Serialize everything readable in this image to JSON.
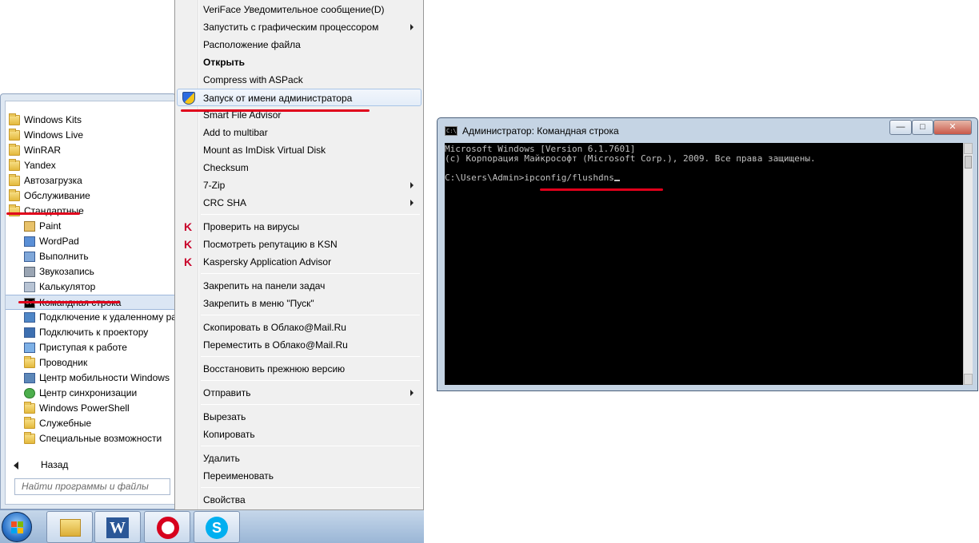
{
  "start_menu": {
    "folders": [
      {
        "label": "Windows Kits"
      },
      {
        "label": "Windows Live"
      },
      {
        "label": "WinRAR"
      },
      {
        "label": "Yandex"
      },
      {
        "label": "Автозагрузка"
      },
      {
        "label": "Обслуживание"
      },
      {
        "label": "Стандартные"
      }
    ],
    "accessories": [
      {
        "label": "Paint",
        "icon": "paint-icon"
      },
      {
        "label": "WordPad",
        "icon": "wordpad-icon"
      },
      {
        "label": "Выполнить",
        "icon": "run-icon"
      },
      {
        "label": "Звукозапись",
        "icon": "microphone-icon"
      },
      {
        "label": "Калькулятор",
        "icon": "calculator-icon"
      },
      {
        "label": "Командная строка",
        "icon": "cmd-icon"
      },
      {
        "label": "Подключение к удаленному ра",
        "icon": "remote-desktop-icon"
      },
      {
        "label": "Подключить к проектору",
        "icon": "projector-icon"
      },
      {
        "label": "Приступая к работе",
        "icon": "getting-started-icon"
      },
      {
        "label": "Проводник",
        "icon": "explorer-icon"
      },
      {
        "label": "Центр мобильности Windows",
        "icon": "mobility-center-icon"
      },
      {
        "label": "Центр синхронизации",
        "icon": "sync-center-icon"
      },
      {
        "label": "Windows PowerShell",
        "icon": "folder-icon"
      },
      {
        "label": "Служебные",
        "icon": "folder-icon"
      },
      {
        "label": "Специальные возможности",
        "icon": "folder-icon"
      }
    ],
    "back_label": "Назад",
    "search_placeholder": "Найти программы и файлы"
  },
  "context_menu": {
    "items": [
      {
        "label": "VeriFace Уведомительное сообщение(D)"
      },
      {
        "label": "Запустить с графическим процессором",
        "submenu": true
      },
      {
        "label": "Расположение файла"
      },
      {
        "label": "Открыть",
        "bold": true
      },
      {
        "label": "Compress with ASPack"
      },
      {
        "label": "Запуск от имени администратора",
        "icon": "uac-shield-icon",
        "highlighted": true
      },
      {
        "label": "Smart File Advisor"
      },
      {
        "label": "Add to multibar"
      },
      {
        "label": "Mount as ImDisk Virtual Disk"
      },
      {
        "label": "Checksum"
      },
      {
        "label": "7-Zip",
        "submenu": true
      },
      {
        "label": "CRC SHA",
        "submenu": true
      },
      {
        "label": "Проверить на вирусы",
        "icon": "kaspersky-icon"
      },
      {
        "label": "Посмотреть репутацию в KSN",
        "icon": "kaspersky-icon"
      },
      {
        "label": "Kaspersky Application Advisor",
        "icon": "kaspersky-icon"
      },
      {
        "label": "Закрепить на панели задач"
      },
      {
        "label": "Закрепить в меню \"Пуск\""
      },
      {
        "label": "Скопировать в Облако@Mail.Ru"
      },
      {
        "label": "Переместить в Облако@Mail.Ru"
      },
      {
        "label": "Восстановить прежнюю версию"
      },
      {
        "label": "Отправить",
        "submenu": true
      },
      {
        "label": "Вырезать"
      },
      {
        "label": "Копировать"
      },
      {
        "label": "Удалить"
      },
      {
        "label": "Переименовать"
      },
      {
        "label": "Свойства"
      }
    ]
  },
  "cmd_window": {
    "title": "Администратор: Командная строка",
    "lines": [
      "Microsoft Windows [Version 6.1.7601]",
      "(c) Корпорация Майкрософт (Microsoft Corp.), 2009. Все права защищены.",
      "",
      "C:\\Users\\Admin>ipconfig/flushdns"
    ],
    "icon_text": "C:\\"
  },
  "taskbar": {
    "buttons": [
      {
        "name": "explorer",
        "icon": "folder-library-icon"
      },
      {
        "name": "word",
        "icon": "word-icon",
        "letter": "W"
      },
      {
        "name": "opera",
        "icon": "opera-icon",
        "letter": "O"
      },
      {
        "name": "skype",
        "icon": "skype-icon",
        "letter": "S"
      }
    ]
  },
  "colors": {
    "highlight_underline": "#e0001b",
    "console_bg": "#000000",
    "console_fg": "#c0c0c0"
  }
}
